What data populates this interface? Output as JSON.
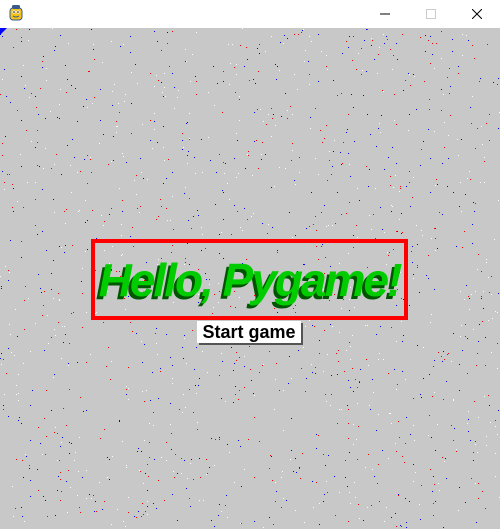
{
  "window": {
    "icon": "pygame-snake-icon",
    "controls": {
      "minimize": "minimize-icon",
      "maximize": "maximize-icon",
      "close": "close-icon"
    }
  },
  "surface": {
    "background_color": "#c8c8c8",
    "noise_colors": [
      "#0000ff",
      "#ff0000",
      "#ffffff"
    ]
  },
  "title": {
    "text": "Hello, Pygame!",
    "text_color": "#00cc00",
    "shadow_color": "#005500",
    "border_color": "#ff0000"
  },
  "start_button": {
    "label": "Start game"
  }
}
